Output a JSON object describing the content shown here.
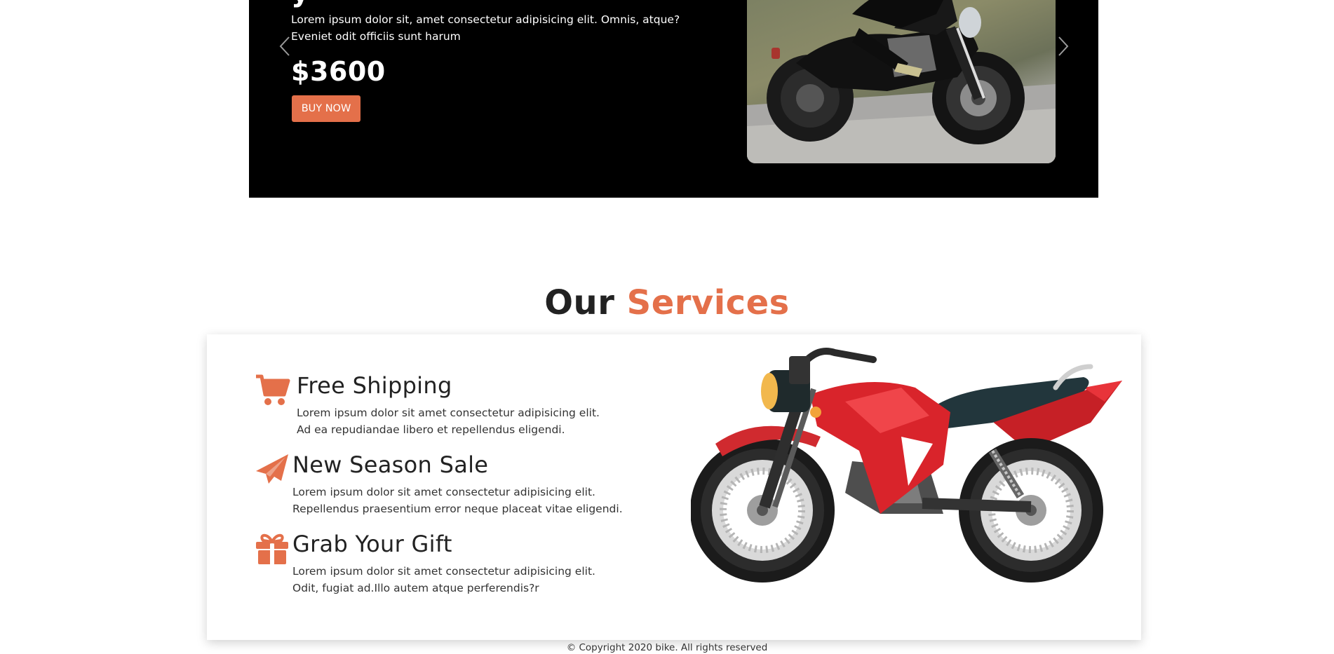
{
  "hero": {
    "title_fragment": "y",
    "description": "Lorem ipsum dolor sit, amet consectetur adipisicing elit. Omnis, atque? Eveniet odit officiis sunt harum",
    "price": "$3600",
    "buy_label": "BUY NOW",
    "image_alt": "black motorcycle photo",
    "prev_icon": "chevron-left-icon",
    "next_icon": "chevron-right-icon"
  },
  "services": {
    "title_plain": "Our",
    "title_accent": "Services",
    "accent_color": "#e4704a",
    "items": [
      {
        "icon": "cart-icon",
        "title": "Free Shipping",
        "line1": "Lorem ipsum dolor sit amet consectetur adipisicing elit.",
        "line2": "Ad ea repudiandae libero et repellendus eligendi."
      },
      {
        "icon": "paper-plane-icon",
        "title": "New Season Sale",
        "line1": "Lorem ipsum dolor sit amet consectetur adipisicing elit.",
        "line2": "Repellendus praesentium error neque placeat vitae eligendi."
      },
      {
        "icon": "gift-icon",
        "title": "Grab Your Gift",
        "line1": "Lorem ipsum dolor sit amet consectetur adipisicing elit.",
        "line2": "Odit, fugiat ad.Illo autem atque perferendis?r"
      }
    ]
  },
  "footer": {
    "copyright": "© Copyright 2020 bike. All rights reserved"
  }
}
